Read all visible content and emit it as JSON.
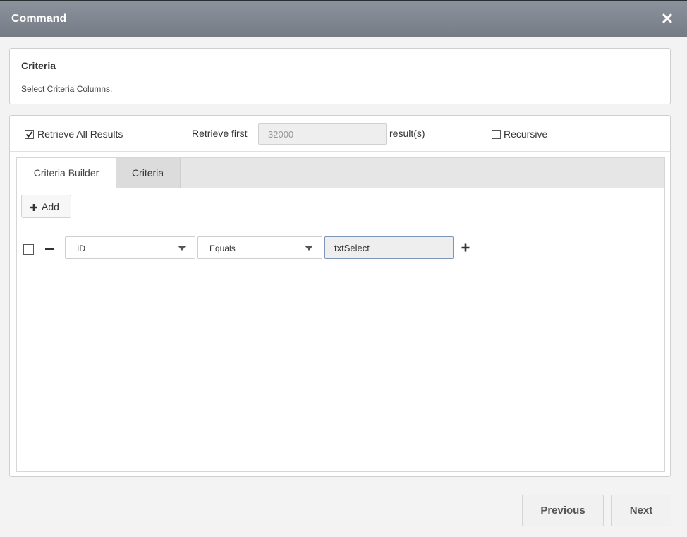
{
  "window": {
    "title": "Command",
    "close_icon": "close-icon"
  },
  "header": {
    "title": "Criteria",
    "subtitle": "Select Criteria Columns."
  },
  "options": {
    "retrieve_all": {
      "label": "Retrieve All Results",
      "checked": true
    },
    "retrieve_first_label": "Retrieve first",
    "retrieve_first_value": "32000",
    "results_suffix": "result(s)",
    "recursive": {
      "label": "Recursive",
      "checked": false
    }
  },
  "tabs": [
    {
      "label": "Criteria Builder",
      "active": true
    },
    {
      "label": "Criteria",
      "active": false
    }
  ],
  "builder": {
    "add_label": "Add",
    "rows": [
      {
        "checked": false,
        "field": "ID",
        "operator": "Equals",
        "value": "txtSelect"
      }
    ]
  },
  "footer": {
    "previous_label": "Previous",
    "next_label": "Next"
  },
  "colors": {
    "titlebar": "#7f858f",
    "input_focus_border": "#7e95b8"
  }
}
